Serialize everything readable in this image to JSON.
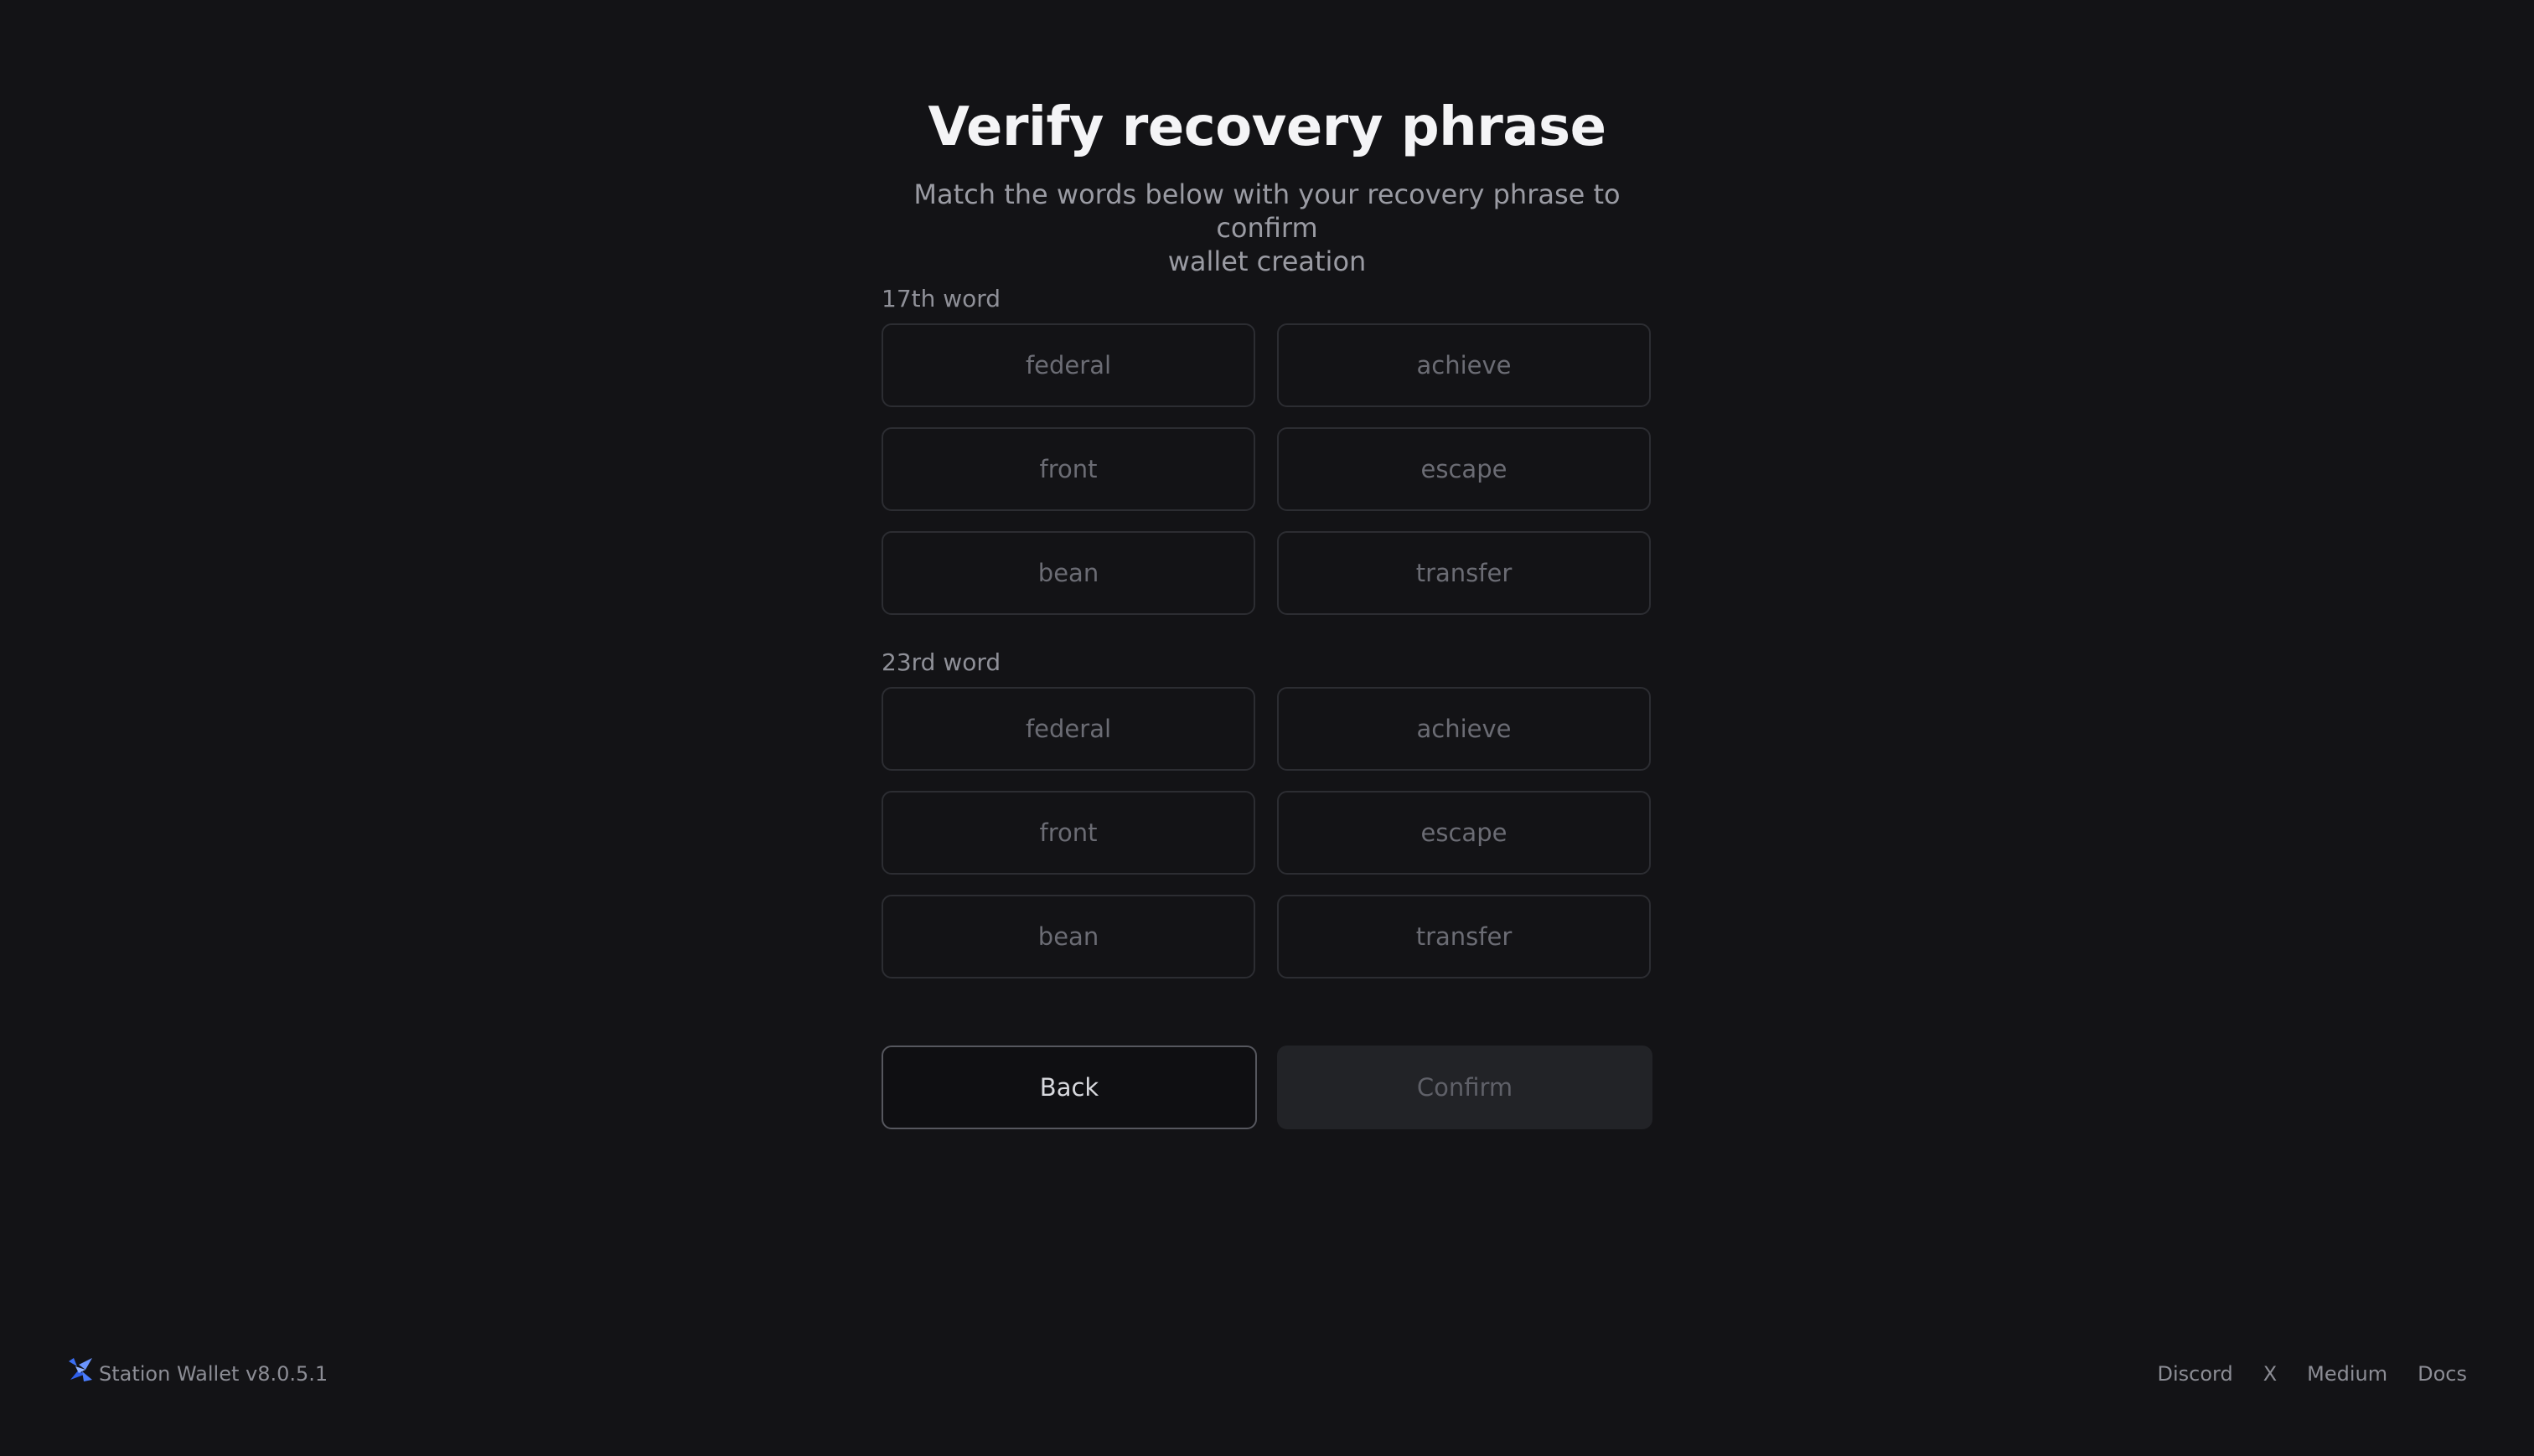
{
  "header": {
    "title": "Verify recovery phrase",
    "subtitle_line1": "Match the words below with your recovery phrase to confirm",
    "subtitle_line2": "wallet creation"
  },
  "questions": [
    {
      "label": "17th word",
      "options": [
        "federal",
        "achieve",
        "front",
        "escape",
        "bean",
        "transfer"
      ]
    },
    {
      "label": "23rd word",
      "options": [
        "federal",
        "achieve",
        "front",
        "escape",
        "bean",
        "transfer"
      ]
    }
  ],
  "actions": {
    "back_label": "Back",
    "confirm_label": "Confirm"
  },
  "footer": {
    "logo_icon": "station-logo-icon",
    "version": "Station Wallet v8.0.5.1",
    "links": [
      "Discord",
      "X",
      "Medium",
      "Docs"
    ]
  },
  "colors": {
    "background": "#131316",
    "accent_logo": "#3b6ff5"
  }
}
